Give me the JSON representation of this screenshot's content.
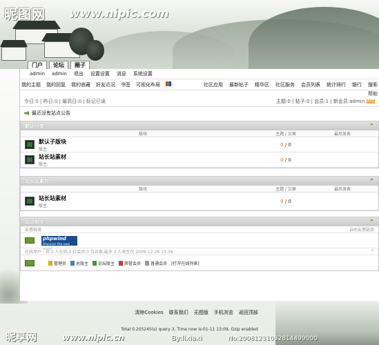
{
  "watermark": {
    "logo": "昵图网",
    "url": "www.nipic.com",
    "bottom_logo": "昵享网",
    "bottom_url": "www.nipic.cn",
    "bottom_by": "By:lixiaxi",
    "bottom_no": "No:20081231032814499000"
  },
  "tabs": [
    "门户",
    "论坛",
    "圈子"
  ],
  "userbar": {
    "items": [
      "admin",
      "admin",
      "退出",
      "设置设置",
      "消息",
      "系统设置"
    ]
  },
  "nav": {
    "left": [
      "我的主题",
      "我的回复",
      "我的收藏",
      "好友近况",
      "书签",
      "可视化布局"
    ],
    "right": [
      "社区应用",
      "最新帖子",
      "精华区",
      "社区服务",
      "会员列表",
      "统计排行",
      "银行",
      "搜索"
    ],
    "help": "帮助"
  },
  "stats": {
    "left": "今日:0 | 昨日:0 | 最高日:0 | 标记已读",
    "right": "主题:0 | 帖子:0 | 会员:1 | 新会员:admin",
    "rss": "RSS"
  },
  "notice": "最近没有站点公告",
  "categories": [
    {
      "title": "默认分类",
      "columns": [
        "版块",
        "主题 / 文章",
        "最后发表"
      ],
      "forums": [
        {
          "name": "默认子版块",
          "mod": "版主:",
          "topics": "0",
          "posts": "0"
        },
        {
          "name": "站长站素材",
          "mod": "版主:",
          "topics": "0",
          "posts": "0"
        }
      ]
    },
    {
      "title": "站长站素材",
      "columns": [
        "版块",
        "主题 / 文章",
        "最后发表"
      ],
      "forums": [
        {
          "name": "站长站素材",
          "mod": "版主:",
          "topics": "0",
          "posts": "0"
        }
      ]
    }
  ],
  "site": {
    "title": "站点相关",
    "links_label": "友情链接",
    "links_right": "自助友情链接",
    "phpwind": "phpwind",
    "phpwind_sub": "Discover the new world",
    "online_label": "在线用户 - 共 2 人在线,2 位会员,0 位访客,最多 2 人发生在 2009-12-28 13:36",
    "legend": [
      "管理员",
      "总版主",
      "论坛版主",
      "荣誉会员",
      "普通会员",
      "[打开在线列表]"
    ]
  },
  "footer": {
    "links": [
      "清除Cookies",
      "联系我们",
      "无图版",
      "手机浏览",
      "返回顶部"
    ],
    "stats": "Total 0.205245(s) query 3, Time now is:01-11 13:09, Gzip enabled"
  },
  "colors": {
    "accent_orange": "#e06a00",
    "section_header": "#c9c9c9",
    "phpwind_blue": "#1b4d8e"
  }
}
